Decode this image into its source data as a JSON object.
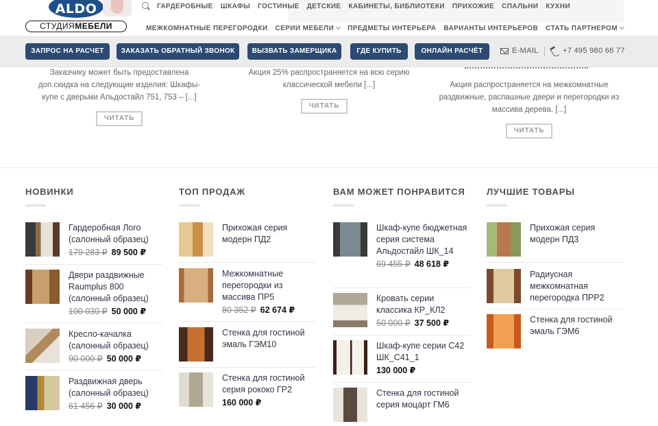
{
  "logo": {
    "brand": "ALDO",
    "subtitle_light": "СТУДИЯ",
    "subtitle_bold": "МЕБЕЛИ"
  },
  "nav": {
    "row1": [
      "ГАРДЕРОБНЫЕ",
      "ШКАФЫ",
      "ГОСТИНЫЕ",
      "ДЕТСКИЕ",
      "КАБИНЕТЫ, БИБЛИОТЕКИ",
      "ПРИХОЖИЕ",
      "СПАЛЬНИ",
      "КУХНИ"
    ],
    "row2": [
      {
        "label": "МЕЖКОМНАТНЫЕ ПЕРЕГОРОДКИ",
        "dropdown": false
      },
      {
        "label": "СЕРИИ МЕБЕЛИ",
        "dropdown": true
      },
      {
        "label": "ПРЕДМЕТЫ ИНТЕРЬЕРА",
        "dropdown": false
      },
      {
        "label": "ВАРИАНТЫ ИНТЕРЬЕРОВ",
        "dropdown": false
      },
      {
        "label": "СТАТЬ ПАРТНЕРОМ",
        "dropdown": true
      }
    ]
  },
  "action_bar": {
    "buttons": [
      "ЗАПРОС НА РАСЧЕТ",
      "ЗАКАЗАТЬ ОБРАТНЫЙ ЗВОНОК",
      "ВЫЗВАТЬ ЗАМЕРЩИКА",
      "ГДЕ КУПИТЬ",
      "ОНЛАЙН РАСЧЁТ"
    ],
    "email_label": "E-MAIL",
    "phone": "+7 495 980 66 77",
    "accent": "#2c4a72"
  },
  "promos": [
    {
      "text": "Заказчику может быть предоставлена доп.скидка на следующие изделия: Шкафы-купе с дверьми Альдостайл 751, 753 – [...]",
      "button": "ЧИТАТЬ"
    },
    {
      "text": "Акция 25% распространяется на всю серию классической мебели [...]",
      "button": "ЧИТАТЬ"
    },
    {
      "text": "Акция распространяется на межкомнатные раздвижные, распашные двери и перегородки из массива дерева. [...]",
      "button": "ЧИТАТЬ"
    }
  ],
  "currency": "₽",
  "columns": [
    {
      "title": "НОВИНКИ",
      "products": [
        {
          "name": "Гардеробная Лого (салонный образец)",
          "old_price": "179 283",
          "price": "89 500"
        },
        {
          "name": "Двери раздвижные Raumplus 800 (салонный образец)",
          "old_price": "100 030",
          "price": "50 000"
        },
        {
          "name": "Кресло-качалка (салонный образец)",
          "old_price": "90 000",
          "price": "50 000"
        },
        {
          "name": "Раздвижная дверь (салонный образец)",
          "old_price": "61 456",
          "price": "30 000"
        }
      ]
    },
    {
      "title": "ТОП ПРОДАЖ",
      "products": [
        {
          "name": "Прихожая серия модерн ПД2",
          "old_price": "",
          "price": ""
        },
        {
          "name": "Межкомнатные перегородки из массива ПР5",
          "old_price": "80 352",
          "price": "62 674"
        },
        {
          "name": "Стенка для гостиной эмаль ГЭМ10",
          "old_price": "",
          "price": ""
        },
        {
          "name": "Стенка для гостиной серия рококо ГР2",
          "old_price": "",
          "price": "160 000"
        }
      ]
    },
    {
      "title": "ВАМ МОЖЕТ ПОНРАВИТСЯ",
      "products": [
        {
          "name": "Шкаф-купе бюджетная серия система Альдостайл ШК_14",
          "old_price": "69 455",
          "price": "48 618"
        },
        {
          "name": "Кровать серии классика КР_КЛ2",
          "old_price": "50 000",
          "price": "37 500"
        },
        {
          "name": "Шкаф-купе серии С42 ШК_С41_1",
          "old_price": "",
          "price": "130 000"
        },
        {
          "name": "Стенка для гостиной серия моцарт ГМ6",
          "old_price": "",
          "price": ""
        }
      ]
    },
    {
      "title": "ЛУЧШИЕ ТОВАРЫ",
      "products": [
        {
          "name": "Прихожая серия модерн ПД3",
          "old_price": "",
          "price": ""
        },
        {
          "name": "Радиусная межкомнатная перегородка ПРР2",
          "old_price": "",
          "price": ""
        },
        {
          "name": "Стенка для гостиной эмаль ГЭМ6",
          "old_price": "",
          "price": ""
        }
      ]
    }
  ]
}
